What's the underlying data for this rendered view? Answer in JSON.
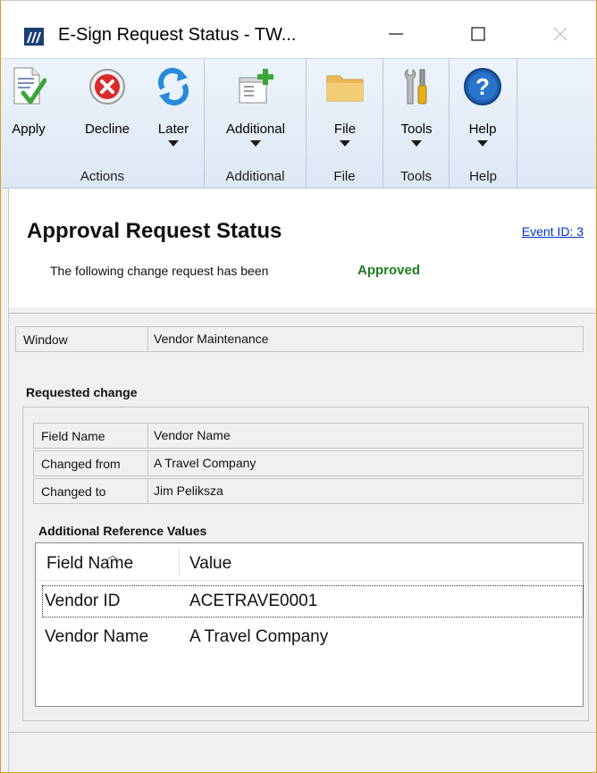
{
  "window": {
    "title": "E-Sign Request Status  -  TW...",
    "minimize_glyph": "—",
    "maximize_glyph": "☐",
    "close_glyph": "✕"
  },
  "ribbon": {
    "groups": [
      {
        "caption": "Actions",
        "buttons": [
          {
            "label": "Apply",
            "icon": "apply-document-check-icon",
            "dropdown": false
          },
          {
            "label": "Decline",
            "icon": "decline-x-icon",
            "dropdown": false
          },
          {
            "label": "Later",
            "icon": "later-refresh-arrows-icon",
            "dropdown": true
          }
        ]
      },
      {
        "caption": "Additional",
        "buttons": [
          {
            "label": "Additional",
            "icon": "additional-add-window-icon",
            "dropdown": true
          }
        ]
      },
      {
        "caption": "File",
        "buttons": [
          {
            "label": "File",
            "icon": "folder-icon",
            "dropdown": true
          }
        ]
      },
      {
        "caption": "Tools",
        "buttons": [
          {
            "label": "Tools",
            "icon": "tools-icon",
            "dropdown": true
          }
        ]
      },
      {
        "caption": "Help",
        "buttons": [
          {
            "label": "Help",
            "icon": "help-question-icon",
            "dropdown": true
          }
        ]
      }
    ]
  },
  "header": {
    "title": "Approval Request Status",
    "event_link": "Event ID: 3",
    "status_prefix": "The following change request has been",
    "status_value": "Approved",
    "status_color": "#1e7d1e"
  },
  "window_field": {
    "label": "Window",
    "value": "Vendor Maintenance"
  },
  "requested_change": {
    "heading": "Requested change",
    "rows": [
      {
        "label": "Field Name",
        "value": "Vendor Name"
      },
      {
        "label": "Changed from",
        "value": "A Travel Company"
      },
      {
        "label": "Changed to",
        "value": "Jim Peliksza"
      }
    ]
  },
  "reference": {
    "heading": "Additional Reference Values",
    "columns": [
      "Field Name",
      "Value"
    ],
    "rows": [
      {
        "field": "Vendor ID",
        "value": "ACETRAVE0001"
      },
      {
        "field": "Vendor Name",
        "value": "A Travel Company"
      }
    ]
  }
}
